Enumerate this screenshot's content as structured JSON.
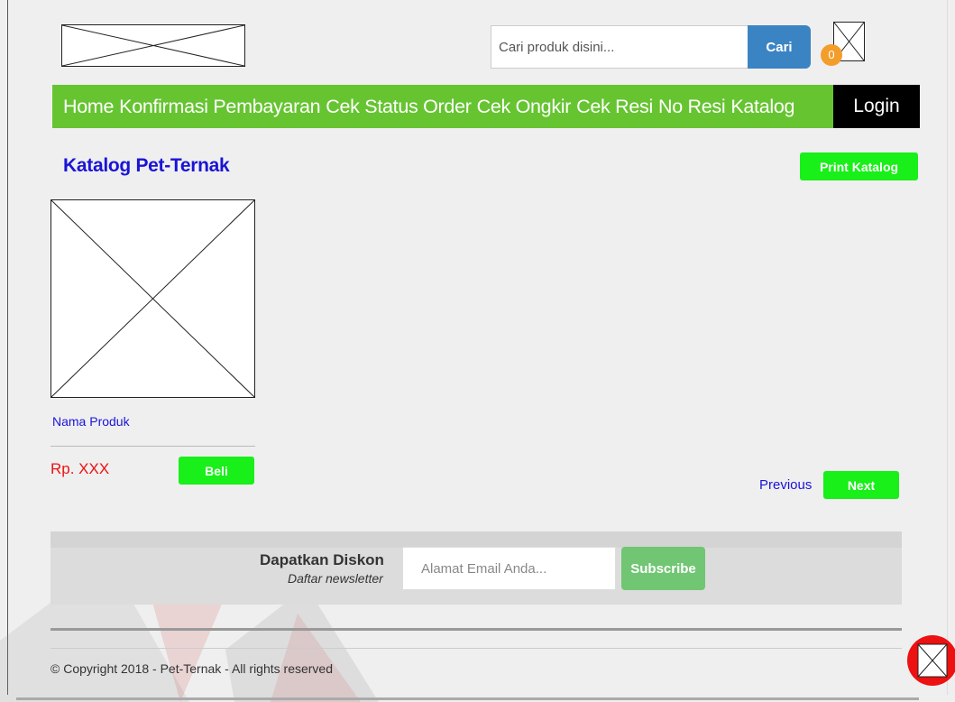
{
  "search": {
    "placeholder": "Cari produk disini...",
    "button_label": "Cari"
  },
  "cart": {
    "count": "0",
    "icon": "broken-image-icon"
  },
  "nav": {
    "items": [
      "Home",
      "Konfirmasi Pembayaran",
      "Cek Status Order",
      "Cek Ongkir",
      "Cek Resi",
      "No Resi",
      "Katalog"
    ],
    "login_label": "Login"
  },
  "page": {
    "title": "Katalog Pet-Ternak",
    "print_label": "Print Katalog"
  },
  "product": {
    "name": "Nama Produk",
    "price": "Rp. XXX",
    "buy_label": "Beli"
  },
  "pagination": {
    "previous_label": "Previous",
    "next_label": "Next"
  },
  "newsletter": {
    "title": "Dapatkan Diskon",
    "subtitle": "Daftar newsletter",
    "email_placeholder": "Alamat Email Anda...",
    "subscribe_label": "Subscribe"
  },
  "footer": {
    "copyright": "© Copyright 2018 - Pet-Ternak - All rights reserved"
  },
  "colors": {
    "nav_green": "#66c431",
    "button_green": "#19ef19",
    "search_blue": "#3b84c4",
    "badge_orange": "#f39d2a",
    "title_blue": "#1a14d6",
    "price_red": "#ee1111",
    "subscribe_green": "#70c672"
  }
}
